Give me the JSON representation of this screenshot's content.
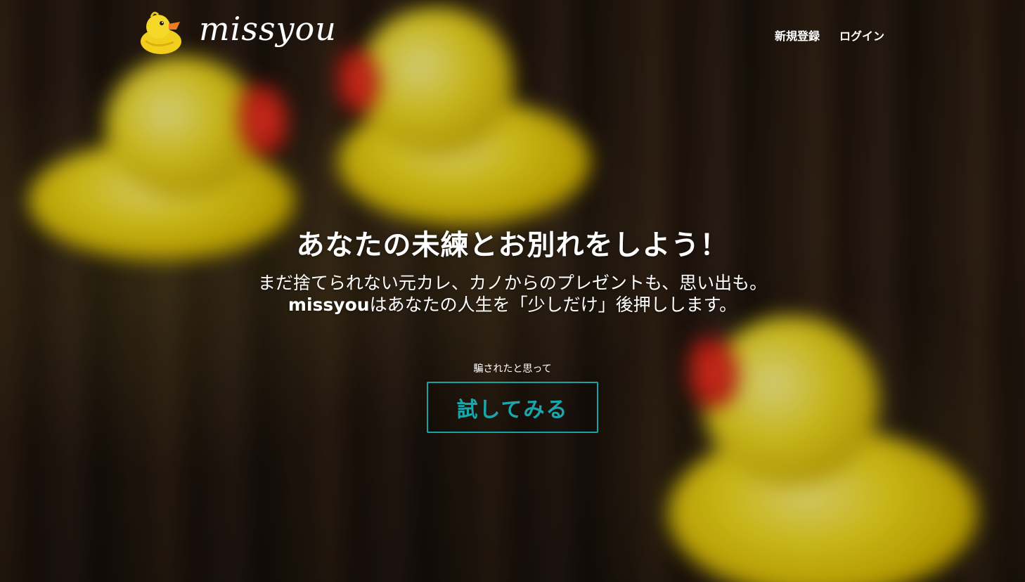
{
  "header": {
    "brand": "missyou",
    "nav": {
      "signup": "新規登録",
      "login": "ログイン"
    }
  },
  "hero": {
    "headline": "あなたの未練とお別れをしよう！",
    "subtext_line1": "まだ捨てられない元カレ、カノからのプレゼントも、思い出も。",
    "subtext_line2_brand": "missyou",
    "subtext_line2_rest": "はあなたの人生を「少しだけ」後押しします。",
    "caption": "騙されたと思って",
    "cta_label": "試してみる"
  },
  "colors": {
    "accent": "#16a3a8",
    "text": "#ffffff",
    "duck_yellow": "#f4dd1a",
    "beak_red": "#c81e12"
  },
  "icons": {
    "logo": "rubber-duck-icon"
  }
}
